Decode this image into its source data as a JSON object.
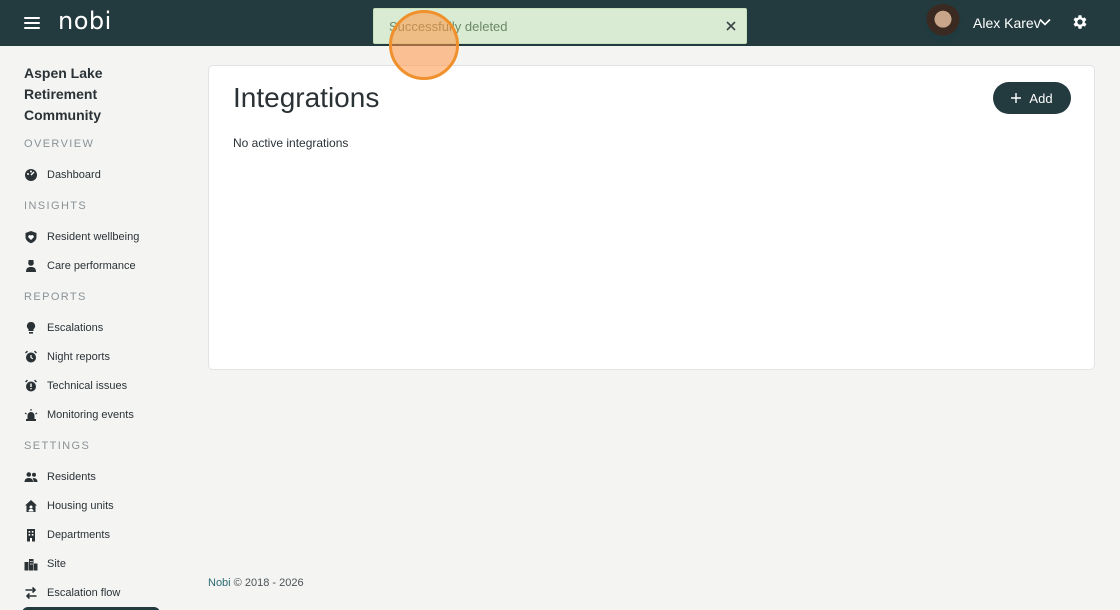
{
  "topbar": {
    "logo": "nobi",
    "user_name": "Alex Karev"
  },
  "toast": {
    "message": "Successfully deleted"
  },
  "sidebar": {
    "site_name": "Aspen Lake Retirement Community",
    "sections": {
      "overview": "OVERVIEW",
      "insights": "INSIGHTS",
      "reports": "REPORTS",
      "settings": "SETTINGS"
    },
    "items": {
      "dashboard": "Dashboard",
      "resident_wellbeing": "Resident wellbeing",
      "care_performance": "Care performance",
      "escalations": "Escalations",
      "night_reports": "Night reports",
      "technical_issues": "Technical issues",
      "monitoring_events": "Monitoring events",
      "residents": "Residents",
      "housing_units": "Housing units",
      "departments": "Departments",
      "site": "Site",
      "escalation_flow": "Escalation flow"
    }
  },
  "main": {
    "title": "Integrations",
    "add_label": "Add",
    "empty_text": "No active integrations"
  },
  "footer": {
    "brand": "Nobi",
    "copyright": " © 2018 - 2026"
  },
  "colors": {
    "topbar": "#233a3e",
    "toast_bg": "#d9ecd3",
    "accent_button": "#233a3e",
    "cursor_ring": "#f0902c"
  }
}
